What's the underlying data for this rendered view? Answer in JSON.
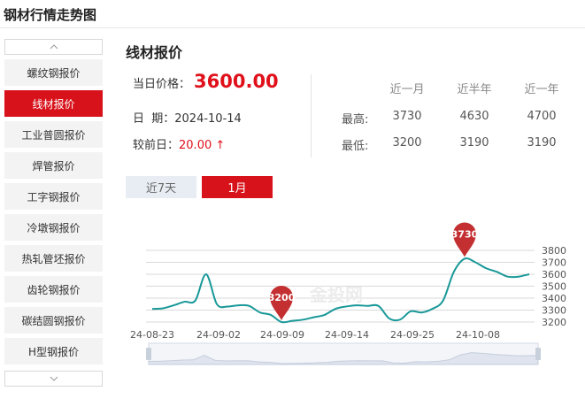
{
  "page": {
    "title": "钢材行情走势图"
  },
  "sidebar": {
    "items": [
      {
        "label": "螺纹钢报价",
        "active": false
      },
      {
        "label": "线材报价",
        "active": true
      },
      {
        "label": "工业普圆报价",
        "active": false
      },
      {
        "label": "焊管报价",
        "active": false
      },
      {
        "label": "工字钢报价",
        "active": false
      },
      {
        "label": "冷墩钢报价",
        "active": false
      },
      {
        "label": "热轧管坯报价",
        "active": false
      },
      {
        "label": "齿轮钢报价",
        "active": false
      },
      {
        "label": "碳结圆钢报价",
        "active": false
      },
      {
        "label": "H型钢报价",
        "active": false
      }
    ],
    "scroll_up_icon": "chevron-up-icon",
    "scroll_down_icon": "chevron-down-icon"
  },
  "main": {
    "section_title": "线材报价",
    "price_label": "当日价格：",
    "price_value": "3600.00",
    "date_label": "日  期：",
    "date_value": "2024-10-14",
    "change_label": "较前日：",
    "change_value": "20.00",
    "change_arrow": "↑",
    "accent_color": "#e0101b"
  },
  "stats": {
    "columns": [
      "近一月",
      "近半年",
      "近一年"
    ],
    "rows": [
      {
        "label": "最高:",
        "values": [
          "3730",
          "4630",
          "4700"
        ]
      },
      {
        "label": "最低:",
        "values": [
          "3200",
          "3190",
          "3190"
        ]
      }
    ]
  },
  "tabs": [
    {
      "label": "近7天",
      "active": false
    },
    {
      "label": "1月",
      "active": true
    }
  ],
  "chart_data": {
    "type": "line",
    "x_ticks": [
      "24-08-23",
      "24-09-02",
      "24-09-09",
      "24-09-14",
      "24-09-25",
      "24-10-08"
    ],
    "y_ticks": [
      3200,
      3300,
      3400,
      3500,
      3600,
      3700,
      3800
    ],
    "ylim": [
      3200,
      3800
    ],
    "grid": true,
    "series": [
      {
        "values": [
          3310,
          3315,
          3340,
          3370,
          3380,
          3600,
          3350,
          3330,
          3340,
          3335,
          3280,
          3260,
          3200,
          3210,
          3220,
          3240,
          3260,
          3310,
          3330,
          3340,
          3335,
          3335,
          3230,
          3220,
          3290,
          3280,
          3310,
          3380,
          3620,
          3730,
          3700,
          3650,
          3620,
          3580,
          3580,
          3600
        ],
        "color": "#199898"
      }
    ],
    "markers": [
      {
        "label": "3200",
        "index": 12
      },
      {
        "label": "3730",
        "index": 29
      }
    ],
    "watermark": "金投网"
  }
}
